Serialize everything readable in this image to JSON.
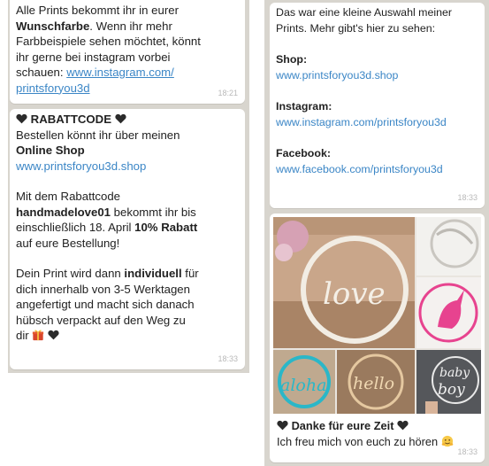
{
  "left": {
    "msg1": {
      "l1": "Alle Prints bekommt ihr in eurer",
      "l2_bold": "Wunschfarbe",
      "l2_rest": ". Wenn ihr mehr",
      "l3": "Farbbeispiele sehen möchtet, könnt",
      "l4": "ihr gerne bei instagram vorbei",
      "l5_pre": "schauen: ",
      "l5_link": "www.instagram.com/",
      "l6_link": "printsforyou3d",
      "time": "18:21"
    },
    "msg2": {
      "title": "RABATTCODE",
      "l1": "Bestellen könnt ihr über meinen",
      "l2_bold": "Online Shop",
      "l3_link": "www.printsforyou3d.shop",
      "p2_l1": "Mit dem Rabattcode",
      "p2_l2_bold": "handmadelove01",
      "p2_l2_rest": " bekommt ihr bis",
      "p2_l3_pre": "einschließlich 18. April ",
      "p2_l3_bold": "10% Rabatt",
      "p2_l4": "auf eure Bestellung!",
      "p3_l1_pre": "Dein Print wird dann ",
      "p3_l1_bold": "individuell",
      "p3_l1_rest": " für",
      "p3_l2": "dich innerhalb von 3-5 Werktagen",
      "p3_l3": "angefertigt und macht sich danach",
      "p3_l4": "hübsch verpackt auf den Weg zu",
      "p3_l5": "dir",
      "time": "18:33"
    }
  },
  "right": {
    "msg1": {
      "l1": "Das war eine kleine Auswahl meiner",
      "l2": "Prints. Mehr gibt's hier zu sehen:",
      "shop_label": "Shop:",
      "shop_link": "www.printsforyou3d.shop",
      "insta_label": "Instagram:",
      "insta_link": "www.instagram.com/printsforyou3d",
      "fb_label": "Facebook:",
      "fb_link": "www.facebook.com/printsforyou3d",
      "time": "18:33"
    },
    "msg2": {
      "photo_words": [
        "love",
        "aloha",
        "hello",
        "baby",
        "boy"
      ],
      "caption_title": "Danke für eure Zeit",
      "caption_line": "Ich freu mich von euch zu hören",
      "time": "18:33"
    }
  },
  "colors": {
    "chat_bg": "#d8d5ce",
    "bubble_bg": "#ffffff",
    "link": "#3b86c6",
    "heart": "#2b2b2b"
  }
}
